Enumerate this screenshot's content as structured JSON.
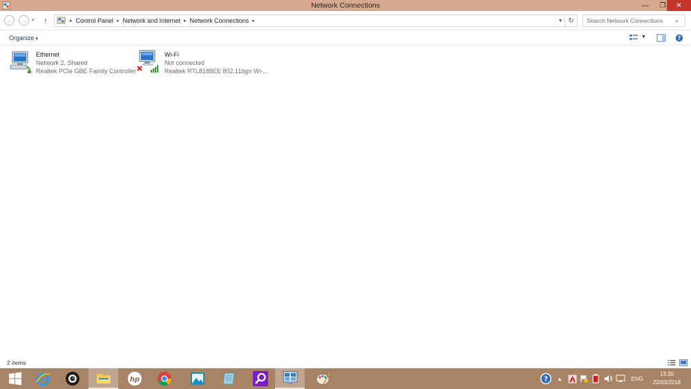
{
  "window": {
    "title": "Network Connections"
  },
  "window_controls": {
    "minimize": "—",
    "maximize": "❐",
    "close": "✕"
  },
  "nav": {
    "back": "←",
    "forward": "→",
    "recent": "▾",
    "up": "↑"
  },
  "breadcrumb": [
    "Control Panel",
    "Network and Internet",
    "Network Connections"
  ],
  "search": {
    "placeholder": "Search Network Connections"
  },
  "toolbar": {
    "organize_label": "Organize",
    "organize_caret": "▾"
  },
  "items": [
    {
      "name": "Ethernet",
      "status": "Network  2, Shared",
      "device": "Realtek PCIe GBE Family Controller",
      "icon": "network-adapter-icon"
    },
    {
      "name": "Wi-Fi",
      "status": "Not connected",
      "device": "Realtek RTL8188EE 802.11bgn Wi-...",
      "icon": "network-adapter-icon"
    }
  ],
  "status_bar": {
    "item_count": "2 items"
  },
  "taskbar": {
    "apps": [
      "start-icon",
      "internet-explorer-icon",
      "camera-app-icon",
      "file-explorer-icon",
      "hp-icon",
      "chrome-icon",
      "photos-icon",
      "notes-icon",
      "search-app-icon",
      "control-panel-icon",
      "paint-icon"
    ]
  },
  "tray": {
    "language": "ENG",
    "time": "13:30",
    "date": "22/03/2018",
    "overflow": "▲"
  },
  "colors": {
    "titlebar": "#d6a98e",
    "close": "#c7362b",
    "taskbar": "#a88366",
    "link": "#1e3a5f"
  }
}
